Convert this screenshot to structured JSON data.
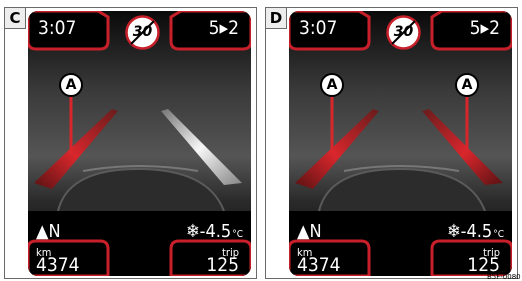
{
  "figure_code": "B5F-0080",
  "panels": [
    {
      "label": "C",
      "time": "3:07",
      "gear": "5▸2",
      "speed_sign": "30",
      "compass_arrow": "▲",
      "compass": "N",
      "temp_icon": "❄",
      "temperature": "-4.5",
      "temperature_unit": "°C",
      "odometer_label": "km",
      "odometer_value": "4374",
      "trip_label": "trip",
      "trip_value": "125",
      "marker_label": "A",
      "lane_assist_left": "active-red",
      "lane_assist_right": "inactive-white"
    },
    {
      "label": "D",
      "time": "3:07",
      "gear": "5▸2",
      "speed_sign": "30",
      "compass_arrow": "▲",
      "compass": "N",
      "temp_icon": "❄",
      "temperature": "-4.5",
      "temperature_unit": "°C",
      "odometer_label": "km",
      "odometer_value": "4374",
      "trip_label": "trip",
      "trip_value": "125",
      "marker_label": "A",
      "lane_assist_left": "active-red",
      "lane_assist_right": "active-red"
    }
  ],
  "colors": {
    "accent_red": "#d8262a",
    "frame_red": "#c8202a",
    "screen_bg": "#000000"
  }
}
